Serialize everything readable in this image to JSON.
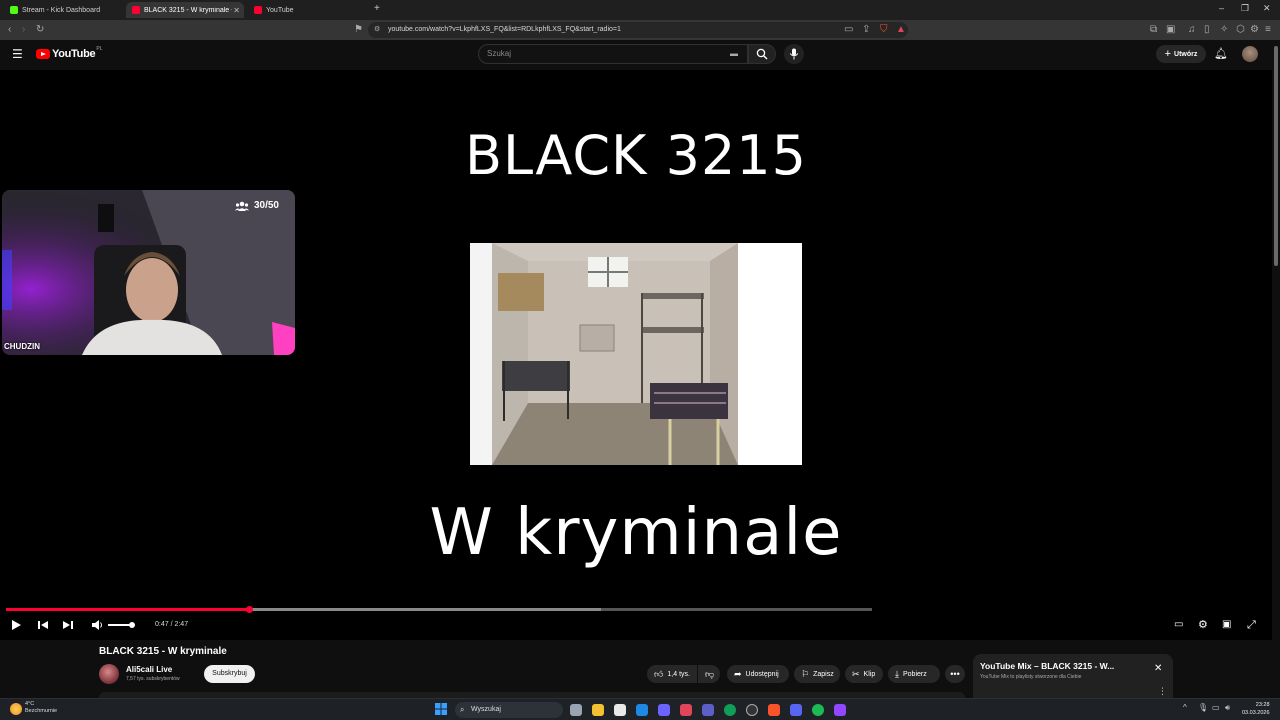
{
  "browser": {
    "tabs": [
      {
        "label": "Stream - Kick Dashboard",
        "favicon_color": "#53fc18"
      },
      {
        "label": "BLACK 3215 - W kryminale - ",
        "favicon_color": "#ff0033"
      },
      {
        "label": "YouTube",
        "favicon_color": "#ff0033"
      }
    ],
    "new_tab_label": "+",
    "url": "youtube.com/watch?v=LkphfLXS_FQ&list=RDLkphfLXS_FQ&start_radio=1"
  },
  "masthead": {
    "logo_text": "YouTube",
    "logo_country": "PL",
    "search_placeholder": "Szukaj",
    "create_label": "Utwórz"
  },
  "video": {
    "frame_title": "BLACK 3215",
    "frame_subtitle": "W kryminale",
    "time_current": "0:47",
    "time_total": "2:47",
    "time_display": "0:47 / 2:47",
    "progress_fraction": 0.2814,
    "buffer_end_fraction": 0.6874,
    "volume_fraction": 1.0
  },
  "webcam": {
    "viewers": "30/50",
    "name": "CHUDZIN"
  },
  "details": {
    "title": "BLACK 3215 - W kryminale",
    "channel": "Ali5cali Live",
    "subscribers": "7,57 tys. subskrybentów",
    "subscribe_label": "Subskrybuj",
    "like_count": "1,4 tys.",
    "share_label": "Udostępnij",
    "save_label": "Zapisz",
    "clip_label": "Klip",
    "download_label": "Pobierz"
  },
  "mix": {
    "title": "YouTube Mix – BLACK 3215 - W...",
    "subtitle": "YouTube Mix to playlisty stworzone dla Ciebie"
  },
  "taskbar": {
    "temperature": "4°C",
    "weather": "Bezchmurnie",
    "search_label": "Wyszukaj",
    "time": "23:28",
    "date": "03.03.2026"
  },
  "colors": {
    "brand_red": "#ff0000",
    "progress_red": "#ff0033",
    "background": "#0f0f0f"
  }
}
